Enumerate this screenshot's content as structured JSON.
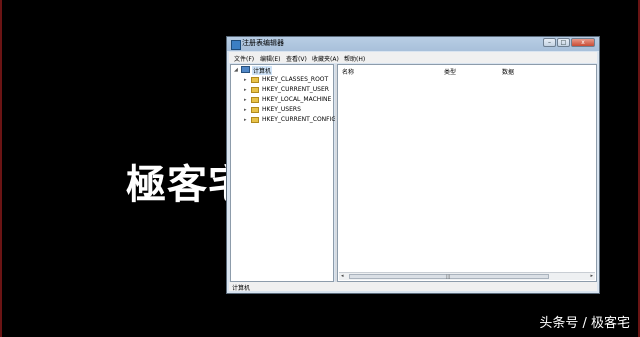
{
  "background": {
    "logo_text": "極客宅",
    "watermark": "头条号 / 极客宅",
    "frame_color": "#6b1414"
  },
  "window": {
    "title": "注册表编辑器",
    "buttons": {
      "minimize": "–",
      "maximize": "□",
      "close": "x"
    }
  },
  "menu": [
    "文件(F)",
    "编辑(E)",
    "查看(V)",
    "收藏夹(A)",
    "帮助(H)"
  ],
  "tree": {
    "root": "计算机",
    "children": [
      "HKEY_CLASSES_ROOT",
      "HKEY_CURRENT_USER",
      "HKEY_LOCAL_MACHINE",
      "HKEY_USERS",
      "HKEY_CURRENT_CONFIG"
    ]
  },
  "list": {
    "columns": [
      "名称",
      "类型",
      "数据"
    ],
    "scroll": {
      "left": "◂",
      "right": "▸",
      "grip": "|||"
    }
  },
  "status": "计算机",
  "icons": {
    "app": "regedit-icon",
    "root": "computer-icon",
    "child": "folder-icon",
    "expand": "▸",
    "collapse": "◢"
  }
}
